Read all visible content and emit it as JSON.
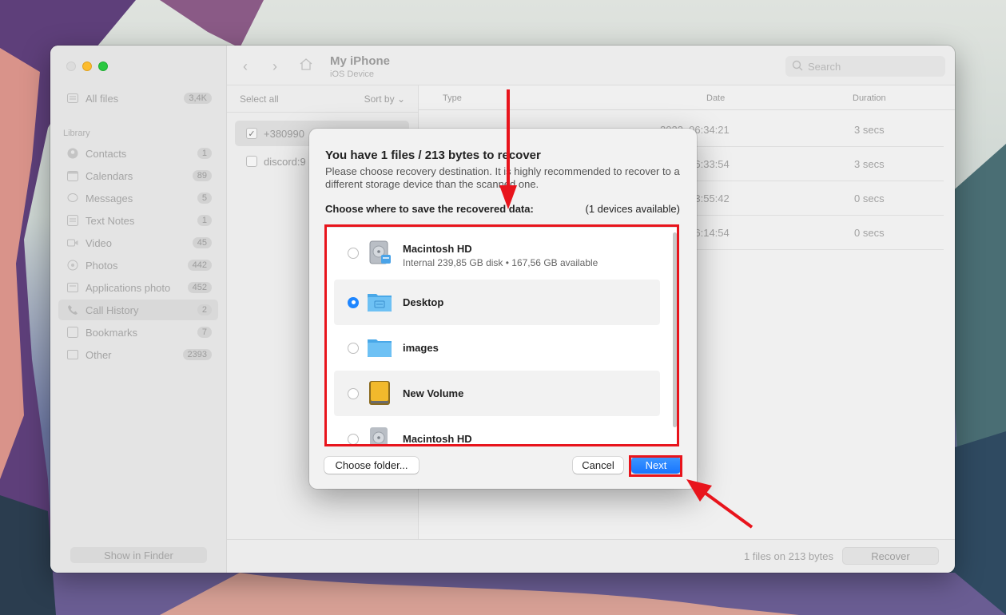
{
  "window": {
    "title": "My iPhone",
    "subtitle": "iOS Device",
    "search_placeholder": "Search"
  },
  "sidebar": {
    "all_files": {
      "label": "All files",
      "count": "3,4K"
    },
    "section_label": "Library",
    "items": [
      {
        "label": "Contacts",
        "count": "1",
        "icon": "contacts-icon"
      },
      {
        "label": "Calendars",
        "count": "89",
        "icon": "calendar-icon"
      },
      {
        "label": "Messages",
        "count": "5",
        "icon": "message-icon"
      },
      {
        "label": "Text Notes",
        "count": "1",
        "icon": "notes-icon"
      },
      {
        "label": "Video",
        "count": "45",
        "icon": "video-icon"
      },
      {
        "label": "Photos",
        "count": "442",
        "icon": "photos-icon"
      },
      {
        "label": "Applications photo",
        "count": "452",
        "icon": "app-photo-icon"
      },
      {
        "label": "Call History",
        "count": "2",
        "icon": "phone-icon"
      },
      {
        "label": "Bookmarks",
        "count": "7",
        "icon": "bookmark-icon"
      },
      {
        "label": "Other",
        "count": "2393",
        "icon": "other-icon"
      }
    ],
    "show_in_finder": "Show in Finder"
  },
  "list": {
    "select_all": "Select all",
    "sort_by": "Sort by",
    "rows": [
      {
        "label": "+380990",
        "checked": true
      },
      {
        "label": "discord:9",
        "checked": false
      }
    ]
  },
  "table": {
    "headers": {
      "type": "Type",
      "date": "Date",
      "duration": "Duration"
    },
    "rows": [
      {
        "date": "2023, 06:34:21",
        "duration": "3 secs"
      },
      {
        "date": "2023, 06:33:54",
        "duration": "3 secs"
      },
      {
        "date": "2023, 13:55:42",
        "duration": "0 secs"
      },
      {
        "date": "2023, 16:14:54",
        "duration": "0 secs"
      }
    ]
  },
  "footer": {
    "info": "1 files on 213 bytes",
    "recover": "Recover"
  },
  "dialog": {
    "title": "You have 1 files / 213 bytes to recover",
    "description": "Please choose recovery destination. It is highly recommended to recover to a different storage device than the scanned one.",
    "choose_label": "Choose where to save the recovered data:",
    "devices_count": "(1 devices available)",
    "destinations": [
      {
        "name": "Macintosh HD",
        "sub": "Internal 239,85 GB disk • 167,56 GB available",
        "selected": false,
        "icon": "hard-drive-icon"
      },
      {
        "name": "Desktop",
        "sub": "",
        "selected": true,
        "icon": "folder-icon"
      },
      {
        "name": "images",
        "sub": "",
        "selected": false,
        "icon": "folder-icon"
      },
      {
        "name": "New Volume",
        "sub": "",
        "selected": false,
        "icon": "external-drive-icon"
      },
      {
        "name": "Macintosh HD",
        "sub": "",
        "selected": false,
        "icon": "hard-drive-icon"
      }
    ],
    "choose_folder": "Choose folder...",
    "cancel": "Cancel",
    "next": "Next"
  },
  "colors": {
    "accent": "#1e86ff",
    "annotation": "#e8141c"
  }
}
